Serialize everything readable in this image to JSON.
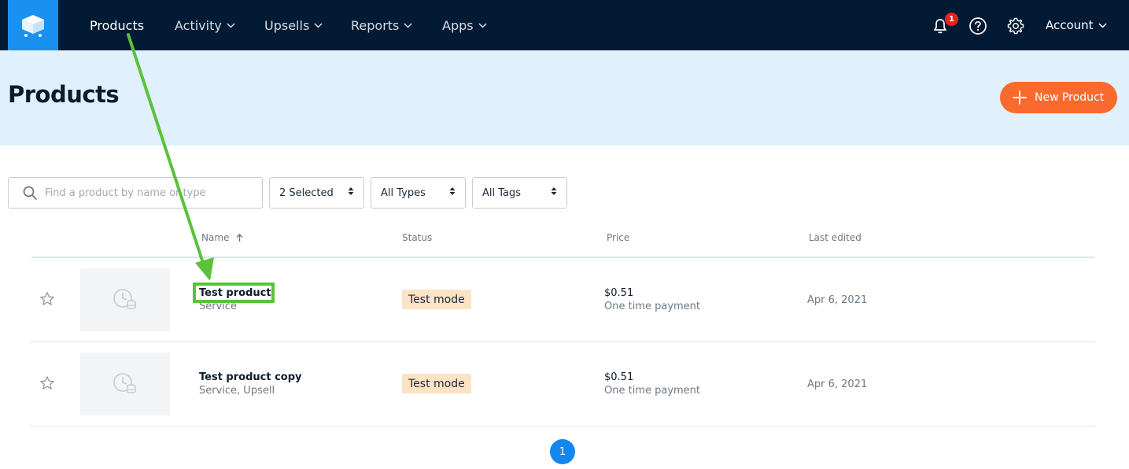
{
  "nav": {
    "items": [
      {
        "label": "Products"
      },
      {
        "label": "Activity"
      },
      {
        "label": "Upsells"
      },
      {
        "label": "Reports"
      },
      {
        "label": "Apps"
      }
    ],
    "notification_count": "1",
    "account_label": "Account"
  },
  "page": {
    "title": "Products",
    "new_button_label": "New Product"
  },
  "filters": {
    "search_placeholder": "Find a product by name or type",
    "status_select": "2 Selected",
    "type_select": "All Types",
    "tag_select": "All Tags"
  },
  "table": {
    "headers": {
      "name": "Name",
      "status": "Status",
      "price": "Price",
      "edited": "Last edited"
    },
    "rows": [
      {
        "name": "Test product",
        "subtitle": "Service",
        "status": "Test mode",
        "price": "$0.51",
        "price_note": "One time payment",
        "edited": "Apr 6, 2021"
      },
      {
        "name": "Test product copy",
        "subtitle": "Service, Upsell",
        "status": "Test mode",
        "price": "$0.51",
        "price_note": "One time payment",
        "edited": "Apr 6, 2021"
      }
    ]
  },
  "pagination": {
    "current": "1"
  },
  "colors": {
    "nav_bg": "#021a33",
    "logo_bg": "#1a90f0",
    "header_band": "#e0f0fd",
    "accent_orange": "#fa6a2e",
    "status_bg": "#fde3c5",
    "annotation_green": "#5ac23a",
    "page_active": "#1387ef",
    "badge_red": "#e8231f"
  },
  "icons": [
    "app-logo-icon",
    "bell-icon",
    "help-icon",
    "gear-icon",
    "chevron-down-icon",
    "plus-icon",
    "search-icon",
    "sort-updown-icon",
    "sort-up-arrow-icon",
    "star-icon",
    "product-placeholder-icon"
  ]
}
